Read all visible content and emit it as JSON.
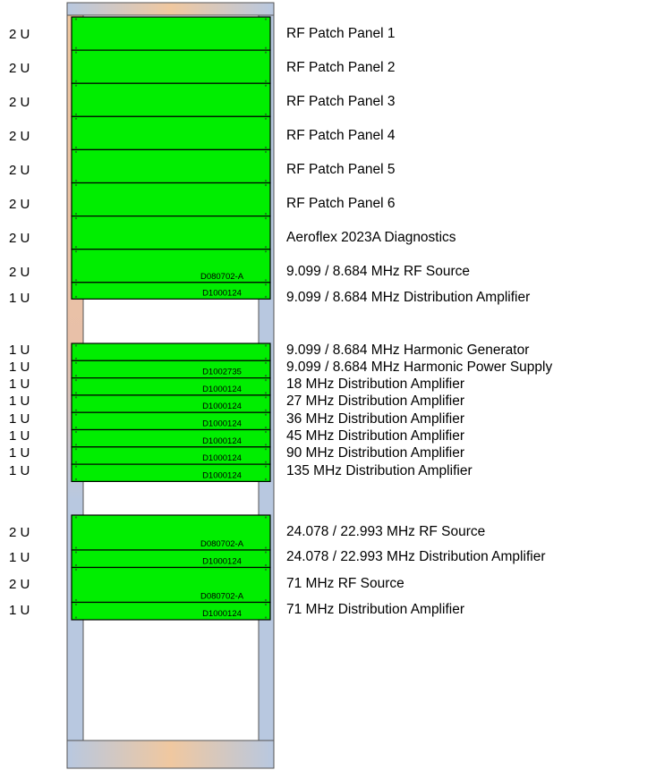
{
  "colors": {
    "rail_fill": "#b8c8e0",
    "rail_stroke": "#555555",
    "rail_accent": "#f0c8a0",
    "unit_fill": "#00ee00",
    "unit_stroke": "#000000"
  },
  "groups": [
    {
      "id": "group-1",
      "units": [
        {
          "u": "2 U",
          "name": "RF Patch Panel 1",
          "part": ""
        },
        {
          "u": "2 U",
          "name": "RF Patch Panel 2",
          "part": ""
        },
        {
          "u": "2 U",
          "name": "RF Patch Panel 3",
          "part": ""
        },
        {
          "u": "2 U",
          "name": "RF Patch Panel 4",
          "part": ""
        },
        {
          "u": "2 U",
          "name": "RF Patch Panel 5",
          "part": ""
        },
        {
          "u": "2 U",
          "name": "RF Patch Panel 6",
          "part": ""
        },
        {
          "u": "2 U",
          "name": "Aeroflex 2023A Diagnostics",
          "part": ""
        },
        {
          "u": "2 U",
          "name": "9.099 / 8.684 MHz RF Source",
          "part": "D080702-A"
        },
        {
          "u": "1 U",
          "name": "9.099 / 8.684 MHz Distribution Amplifier",
          "part": "D1000124"
        }
      ]
    },
    {
      "id": "group-2",
      "units": [
        {
          "u": "1 U",
          "name": "9.099 / 8.684 MHz Harmonic Generator",
          "part": ""
        },
        {
          "u": "1 U",
          "name": "9.099 / 8.684 MHz Harmonic Power Supply",
          "part": "D1002735"
        },
        {
          "u": "1 U",
          "name": "18 MHz Distribution Amplifier",
          "part": "D1000124"
        },
        {
          "u": "1 U",
          "name": "27 MHz Distribution Amplifier",
          "part": "D1000124"
        },
        {
          "u": "1 U",
          "name": "36 MHz Distribution Amplifier",
          "part": "D1000124"
        },
        {
          "u": "1 U",
          "name": "45 MHz Distribution Amplifier",
          "part": "D1000124"
        },
        {
          "u": "1 U",
          "name": "90 MHz Distribution Amplifier",
          "part": "D1000124"
        },
        {
          "u": "1 U",
          "name": "135 MHz Distribution Amplifier",
          "part": "D1000124"
        }
      ]
    },
    {
      "id": "group-3",
      "units": [
        {
          "u": "2 U",
          "name": "24.078 / 22.993 MHz RF Source",
          "part": "D080702-A"
        },
        {
          "u": "1 U",
          "name": "24.078 / 22.993 MHz Distribution Amplifier",
          "part": "D1000124"
        },
        {
          "u": "2 U",
          "name": "71 MHz RF Source",
          "part": "D080702-A"
        },
        {
          "u": "1 U",
          "name": "71 MHz Distribution Amplifier",
          "part": "D1000124"
        }
      ]
    }
  ]
}
